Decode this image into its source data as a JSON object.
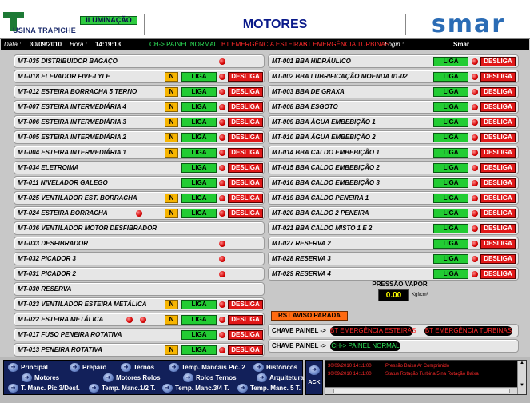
{
  "header": {
    "plant_name": "USINA TRAPICHE",
    "lighting_button": "ILUMINAÇÃO",
    "title": "MOTORES",
    "brand": "smar"
  },
  "status_bar": {
    "date_label": "Data :",
    "date": "30/09/2010",
    "time_label": "Hora :",
    "time": "14:19:13",
    "panel_status": "CH-> PAINEL NORMAL",
    "emerg_esteiras": "BT EMERGÊNCIA ESTEIRAS",
    "emerg_turbinas": "BT EMERGÊNCIA TURBINAS",
    "login_label": "Login :",
    "login_user": "Smar"
  },
  "controls": {
    "n": "N",
    "liga": "LIGA",
    "desliga": "DESLIGA"
  },
  "left_rows": [
    {
      "label": "MT-035 DISTRIBUIDOR BAGAÇO"
    },
    {
      "label": "MT-018 ELEVADOR FIVE-LYLE"
    },
    {
      "label": "MT-012 ESTEIRA BORRACHA 5 TERNO"
    },
    {
      "label": "MT-007 ESTEIRA INTERMEDIÁRIA 4"
    },
    {
      "label": "MT-006 ESTEIRA INTERMEDIÁRIA 3"
    },
    {
      "label": "MT-005 ESTEIRA INTERMEDIÁRIA 2"
    },
    {
      "label": "MT-004 ESTEIRA INTERMEDIÁRIA 1"
    },
    {
      "label": "MT-034 ELETROIMA"
    },
    {
      "label": "MT-011 NIVELADOR GALEGO"
    },
    {
      "label": "MT-025 VENTILADOR EST. BORRACHA"
    },
    {
      "label": "MT-024 ESTEIRA BORRACHA"
    },
    {
      "label": "MT-036 VENTILADOR MOTOR DESFIBRADOR"
    },
    {
      "label": "MT-033 DESFIBRADOR"
    },
    {
      "label": "MT-032 PICADOR 3"
    },
    {
      "label": "MT-031 PICADOR 2"
    },
    {
      "label": "MT-030 RESERVA"
    },
    {
      "label": "MT-023 VENTILADOR ESTEIRA METÁLICA"
    },
    {
      "label": "MT-022 ESTEIRA METÁLICA"
    },
    {
      "label": "MT-017 FUSO PENEIRA ROTATIVA"
    },
    {
      "label": "MT-013 PENEIRA ROTATIVA"
    }
  ],
  "right_rows": [
    {
      "label": "MT-001 BBA HIDRÁULICO"
    },
    {
      "label": "MT-002 BBA LUBRIFICAÇÃO MOENDA 01-02"
    },
    {
      "label": "MT-003 BBA DE GRAXA"
    },
    {
      "label": "MT-008 BBA ESGOTO"
    },
    {
      "label": "MT-009 BBA ÁGUA EMBEBIÇÃO 1"
    },
    {
      "label": "MT-010 BBA ÁGUA EMBEBIÇÃO 2"
    },
    {
      "label": "MT-014 BBA CALDO EMBEBIÇÃO 1"
    },
    {
      "label": "MT-015 BBA CALDO EMBEBIÇÃO 2"
    },
    {
      "label": "MT-016 BBA CALDO EMBEBIÇÃO 3"
    },
    {
      "label": "MT-019 BBA CALDO PENEIRA 1"
    },
    {
      "label": "MT-020 BBA CALDO 2 PENEIRA"
    },
    {
      "label": "MT-021 BBA CALDO MISTO 1 E 2"
    },
    {
      "label": "MT-027 RESERVA 2"
    },
    {
      "label": "MT-028 RESERVA 3"
    },
    {
      "label": "MT-029 RESERVA 4"
    }
  ],
  "pressure": {
    "title": "PRESSÃO VAPOR",
    "value": "0.00",
    "unit": "Kgf/cm²"
  },
  "rst_button": "RST AVISO PARADA",
  "chave": {
    "label1": "CHAVE PAINEL ->",
    "pill1": "BT EMERGÊNCIA ESTEIRAS",
    "pill2": "BT EMERGÊNCIA TURBINAS",
    "label2": "CHAVE PAINEL ->",
    "pill3": "CH-> PAINEL NORMAL"
  },
  "nav": {
    "principal": "Principal",
    "preparo": "Preparo",
    "ternos": "Ternos",
    "temp_mancais": "Temp. Mancais Pic. 2",
    "historicos": "Históricos",
    "motores": "Motores",
    "motores_rolos": "Motores Rolos",
    "rolos_ternos": "Rolos Ternos",
    "arquitetura": "Arquitetura",
    "t_manc_pic3": "T. Manc. Pic.3/Desf.",
    "temp_manc12": "Temp. Manc.1/2 T.",
    "temp_manc34": "Temp. Manc.3/4 T.",
    "temp_manc5": "Temp. Manc. 5 T.",
    "ack": "ACK"
  },
  "alarms": [
    {
      "date": "30/09/2010 14:11:00",
      "text": "Pressão Baixa Ar Comprimido"
    },
    {
      "date": "30/09/2010 14:11:00",
      "text": "Status Rotação Turbina 5 na Rotação Baixa"
    }
  ]
}
